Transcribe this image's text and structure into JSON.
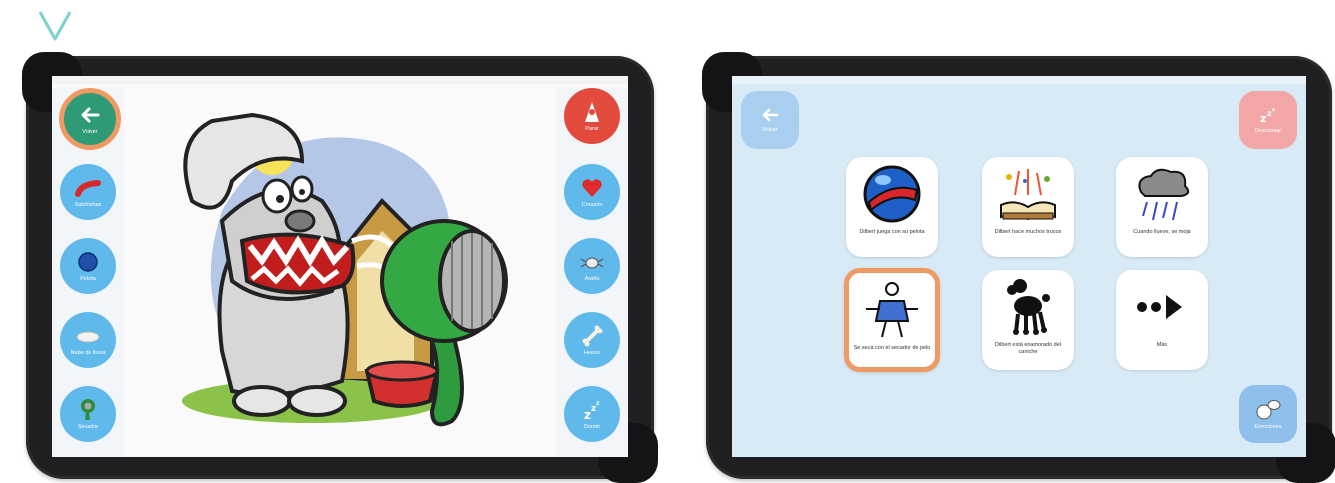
{
  "screen1": {
    "left_buttons": [
      {
        "label": "Volver",
        "icon": "arrow-left-icon"
      },
      {
        "label": "Salchichas",
        "icon": "sausage-icon"
      },
      {
        "label": "Pelota",
        "icon": "ball-icon"
      },
      {
        "label": "Nube de lluvia",
        "icon": "cloud-icon"
      },
      {
        "label": "Secador",
        "icon": "hair-dryer-icon"
      }
    ],
    "right_buttons": [
      {
        "label": "Parar",
        "icon": "stop-icon"
      },
      {
        "label": "Corazón",
        "icon": "heart-icon"
      },
      {
        "label": "Araña",
        "icon": "spider-icon"
      },
      {
        "label": "Hueso",
        "icon": "bone-icon"
      },
      {
        "label": "Dormir",
        "icon": "sleep-icon"
      }
    ]
  },
  "screen2": {
    "back_button": "Volver",
    "rest_button": "Descansar",
    "feelings_button": "Emociones",
    "tiles": [
      {
        "caption": "Dilbert juega con su pelota"
      },
      {
        "caption": "Dilbert hace muchos trucos"
      },
      {
        "caption": "Cuando llueve, se moja"
      },
      {
        "caption": "Se seca con el secador de pelo"
      },
      {
        "caption": "Dilbert está enamorado del caniche"
      },
      {
        "caption": "Más"
      }
    ]
  },
  "colors": {
    "accent_orange": "#ef9a63",
    "button_blue": "#5fb9ea",
    "back_green": "#2f9b76",
    "stop_red": "#e24a3c",
    "teal_logo": "#7fd3cf"
  }
}
